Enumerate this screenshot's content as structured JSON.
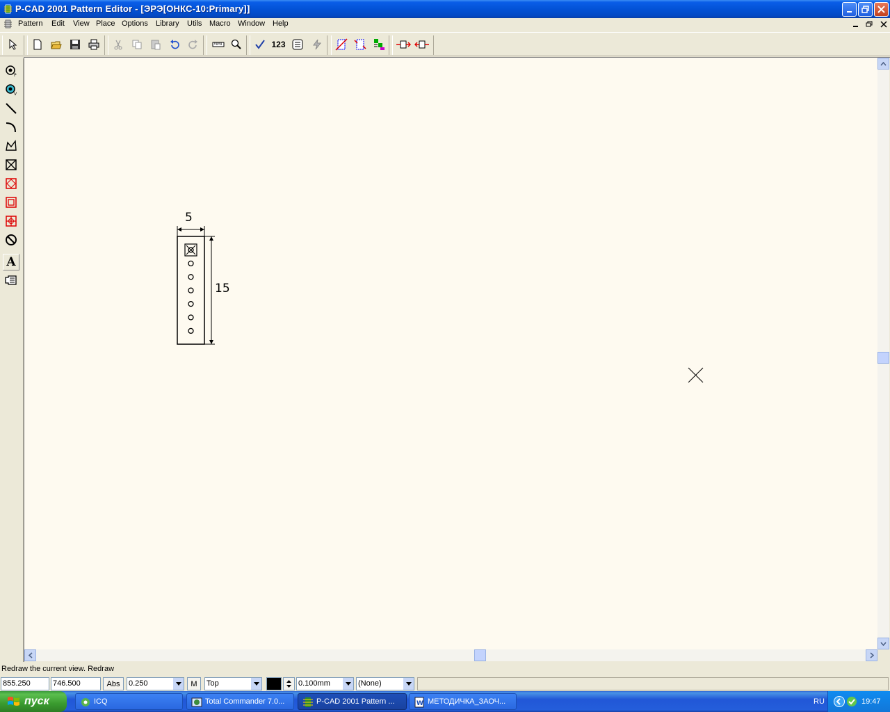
{
  "window": {
    "title": "P-CAD 2001 Pattern Editor - [ЭРЭ[ОНКС-10:Primary]]"
  },
  "menu": [
    "Pattern",
    "Edit",
    "View",
    "Place",
    "Options",
    "Library",
    "Utils",
    "Macro",
    "Window",
    "Help"
  ],
  "toolbar": {
    "numbering_label": "123"
  },
  "toolbox": {
    "text_tool_label": "A"
  },
  "drawing": {
    "dim_width": "5",
    "dim_height": "15",
    "pad_count": 7,
    "cursor_marker": "×"
  },
  "status": {
    "message": "Redraw the current view. Redraw",
    "x_coord": "855.250",
    "y_coord": "746.500",
    "abs_label": "Abs",
    "grid": "0.250",
    "m_label": "M",
    "layer": "Top",
    "line_width": "0.100mm",
    "net": "(None)"
  },
  "taskbar": {
    "start_label": "пуск",
    "tasks": [
      "ICQ",
      "Total Commander 7.0...",
      "P-CAD 2001 Pattern ...",
      "МЕТОДИЧКА_ЗАОЧ..."
    ],
    "lang": "RU",
    "time": "19:47"
  },
  "colors": {
    "canvas": "#fefaf0",
    "title_blue": "#0352d6",
    "taskbar_blue": "#245edb",
    "start_green": "#3a9b2f"
  }
}
